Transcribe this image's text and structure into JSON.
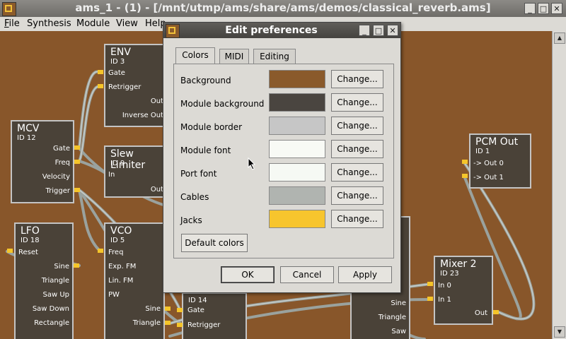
{
  "window": {
    "title": "ams_1 - (1) - [/mnt/utmp/ams/share/ams/demos/classical_reverb.ams]"
  },
  "menu": [
    "File",
    "Synthesis",
    "Module",
    "View",
    "Help"
  ],
  "modules": {
    "env": {
      "name": "ENV",
      "id": "ID 3",
      "ports": [
        "Gate",
        "Retrigger",
        "Out",
        "Inverse Out"
      ]
    },
    "mcv": {
      "name": "MCV",
      "id": "ID 12",
      "ports": [
        "Gate",
        "Freq",
        "Velocity",
        "Trigger"
      ]
    },
    "slew": {
      "name": "Slew Limiter",
      "id": "ID 9",
      "ports": [
        "In",
        "Out"
      ]
    },
    "lfo": {
      "name": "LFO",
      "id": "ID 18",
      "ports": [
        "Reset",
        "Sine",
        "Triangle",
        "Saw Up",
        "Saw Down",
        "Rectangle"
      ]
    },
    "vco": {
      "name": "VCO",
      "id": "ID 5",
      "ports": [
        "Freq",
        "Exp. FM",
        "Lin. FM",
        "PW",
        "Sine",
        "Triangle"
      ]
    },
    "env2": {
      "id": "ID 14",
      "ports": [
        "Gate",
        "Retrigger"
      ]
    },
    "lfo2": {
      "ports": [
        "Sine",
        "Triangle",
        "Saw"
      ]
    },
    "pcm": {
      "name": "PCM Out",
      "id": "ID 1",
      "ports": [
        "-> Out  0",
        "-> Out  1"
      ]
    },
    "mixer": {
      "name": "Mixer 2",
      "id": "ID 23",
      "ports": [
        "In 0",
        "In 1",
        "Out"
      ]
    }
  },
  "dialog": {
    "title": "Edit preferences",
    "tabs": [
      "Colors",
      "MIDI",
      "Editing"
    ],
    "active_tab": "Colors",
    "change_label": "Change...",
    "rows": [
      {
        "label": "Background",
        "color": "#8a5a2b"
      },
      {
        "label": "Module background",
        "color": "#4a4540"
      },
      {
        "label": "Module border",
        "color": "#c6c6c6"
      },
      {
        "label": "Module font",
        "color": "#f8faf5"
      },
      {
        "label": "Port font",
        "color": "#f6f9f4"
      },
      {
        "label": "Cables",
        "color": "#b0b4b0"
      },
      {
        "label": "Jacks",
        "color": "#f7c52d"
      }
    ],
    "default_colors": "Default colors",
    "ok": "OK",
    "cancel": "Cancel",
    "apply": "Apply"
  },
  "colors": {
    "canvas": "#88562a",
    "jack": "#f5c52a",
    "cable": "#a8b0ac"
  }
}
